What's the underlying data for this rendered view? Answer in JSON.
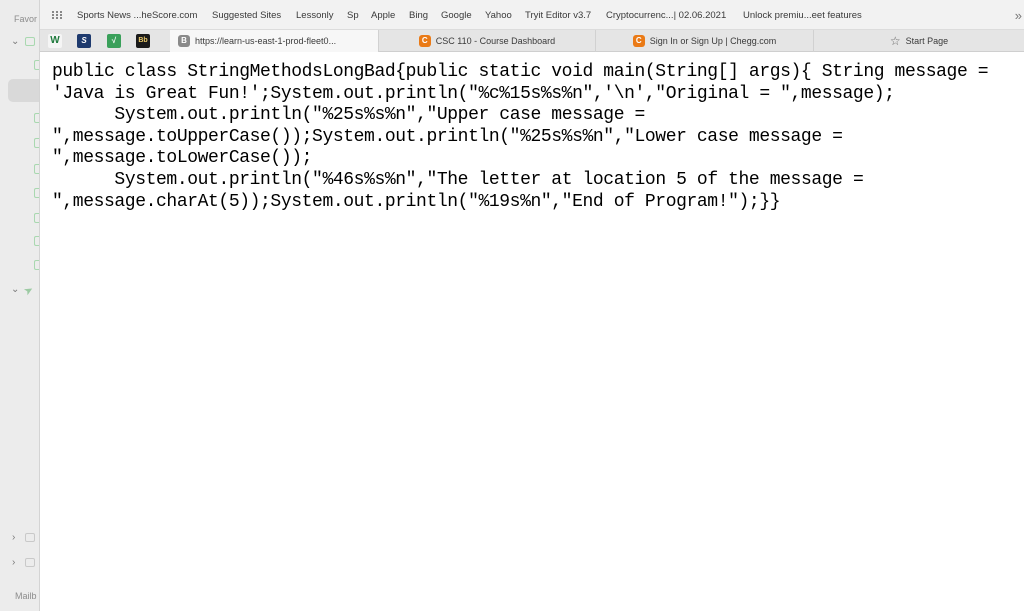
{
  "sidebar": {
    "favorites_label": "Favor",
    "mailboxes_label": "Mailb"
  },
  "favorites_bar": {
    "items": [
      "Sports News ...heScore.com",
      "Suggested Sites",
      "Lessonly",
      "Sp",
      "Apple",
      "Bing",
      "Google",
      "Yahoo",
      "Tryit Editor v3.7",
      "Cryptocurrenc...| 02.06.2021",
      "Unlock premiu...eet features"
    ],
    "more_glyph": "»"
  },
  "tab_bar": {
    "pinned": [
      "W",
      "S",
      "√",
      "Bb"
    ],
    "tabs": [
      {
        "favicon": "B",
        "title": "https://learn-us-east-1-prod-fleet0..."
      },
      {
        "favicon": "C",
        "title": "CSC 110 - Course Dashboard"
      },
      {
        "favicon": "C",
        "title": "Sign In or Sign Up | Chegg.com"
      },
      {
        "favicon": "☆",
        "title": "Start Page"
      }
    ]
  },
  "document": {
    "code": "public class StringMethodsLongBad{public static void main(String[] args){ String message = 'Java is Great Fun!';System.out.println(\"%c%15s%s%n\",'\\n',\"Original = \",message);\n      System.out.println(\"%25s%s%n\",\"Upper case message = \",message.toUpperCase());System.out.println(\"%25s%s%n\",\"Lower case message = \",message.toLowerCase());\n      System.out.println(\"%46s%s%n\",\"The letter at location 5 of the message = \",message.charAt(5));System.out.println(\"%19s%n\",\"End of Program!\");}}"
  },
  "colors": {
    "chegg_orange": "#ea7a16",
    "sidebar_bg": "#ececec",
    "tab_bar_bg": "#e5e5e5"
  }
}
